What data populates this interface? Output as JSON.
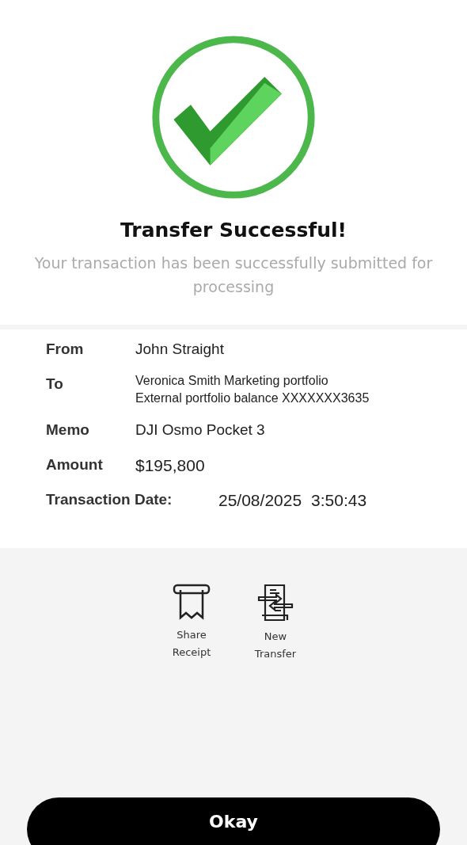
{
  "title": "Transfer Successful!",
  "subtitle": "Your transaction has been successfully submitted for processing",
  "details": [
    {
      "label": "From",
      "lines": [
        "John Straight"
      ]
    },
    {
      "label": "To",
      "lines": [
        "Veronica Smith Marketing portfolio",
        "External portfolio balance XXXXXXX3635"
      ]
    },
    {
      "label": "Memo",
      "lines": [
        "DJI Osmo Pocket 3"
      ]
    },
    {
      "label": "Amount",
      "lines": [
        "$195,800"
      ]
    }
  ],
  "transaction_date": {
    "label": "Transaction Date:",
    "date": "25/08/2025",
    "time": "3:50:43"
  },
  "actions": [
    {
      "kind": "receipt",
      "lines": [
        "Share",
        "Receipt"
      ]
    },
    {
      "kind": "transfer",
      "lines": [
        "New",
        "Transfer"
      ]
    }
  ],
  "button": "Okay"
}
